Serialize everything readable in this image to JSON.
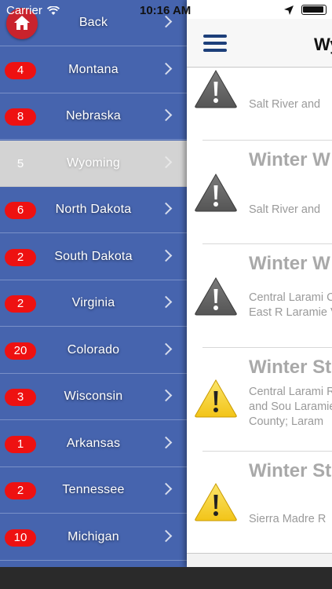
{
  "status_bar": {
    "carrier": "Carrier",
    "time": "10:16 AM"
  },
  "menu": {
    "back_label": "Back",
    "items": [
      {
        "label": "Montana",
        "count": "4"
      },
      {
        "label": "Nebraska",
        "count": "8"
      },
      {
        "label": "Wyoming",
        "count": "5",
        "selected": true
      },
      {
        "label": "North Dakota",
        "count": "6"
      },
      {
        "label": "South Dakota",
        "count": "2"
      },
      {
        "label": "Virginia",
        "count": "2"
      },
      {
        "label": "Colorado",
        "count": "20"
      },
      {
        "label": "Wisconsin",
        "count": "3"
      },
      {
        "label": "Arkansas",
        "count": "1"
      },
      {
        "label": "Tennessee",
        "count": "2"
      },
      {
        "label": "Michigan",
        "count": "10"
      }
    ]
  },
  "panel": {
    "title": "Wy",
    "alerts": [
      {
        "title": "",
        "body": "Salt River and",
        "icon": "warning-gray-icon"
      },
      {
        "title": "Winter W",
        "body": "Salt River and",
        "icon": "warning-gray-icon"
      },
      {
        "title": "Winter W",
        "body": "Central Larami County; East R Laramie Valley",
        "icon": "warning-gray-icon"
      },
      {
        "title": "Winter St",
        "body": "Central Larami Range and Sou Laramie Count County; Laram",
        "icon": "warning-yellow-icon"
      },
      {
        "title": "Winter St",
        "body": "Sierra Madre R",
        "icon": "warning-yellow-icon"
      }
    ]
  },
  "colors": {
    "menu_bg": "#4664ae",
    "selected_row_bg": "#d3d3d3",
    "badge_red": "#ee1111",
    "home_button": "#c9232d",
    "hamburger": "#1d3f7a",
    "warning_gray": "#555555",
    "warning_yellow": "#f2c418"
  }
}
